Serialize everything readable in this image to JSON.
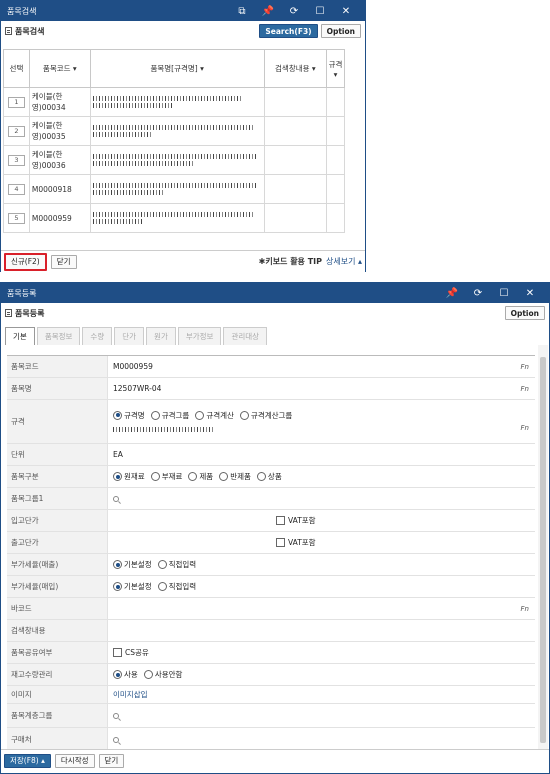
{
  "search_window": {
    "title": "품목검색",
    "header_title": "품목검색",
    "search_button": "Search(F3)",
    "option_button": "Option",
    "columns": [
      "선택",
      "품목코드 ▾",
      "품목명[규격명] ▾",
      "검색창내용 ▾",
      "규격 ▾"
    ],
    "rows": [
      {
        "num": "1",
        "code": "케이블(한영)00034"
      },
      {
        "num": "2",
        "code": "케이블(한영)00035"
      },
      {
        "num": "3",
        "code": "케이블(한영)00036"
      },
      {
        "num": "4",
        "code": "M0000918"
      },
      {
        "num": "5",
        "code": "M0000959"
      }
    ],
    "new_button": "신규(F2)",
    "close_button": "닫기",
    "tip_text": "✱키보드 활용 TIP",
    "detail_link": "상세보기 ▴"
  },
  "register_window": {
    "title": "품목등록",
    "header_title": "품목등록",
    "option_button": "Option",
    "tabs": [
      "기본",
      "품목정보",
      "수량",
      "단가",
      "원가",
      "부가정보",
      "관리대상"
    ],
    "fields": {
      "item_code": {
        "label": "품목코드",
        "value": "M0000959"
      },
      "item_name": {
        "label": "품목명",
        "value": "12507WR-04"
      },
      "spec": {
        "label": "규격",
        "options": [
          "규격명",
          "규격그룹",
          "규격계산",
          "규격계산그룹"
        ]
      },
      "unit": {
        "label": "단위",
        "value": "EA"
      },
      "item_type": {
        "label": "품목구분",
        "options": [
          "원재료",
          "부재료",
          "제품",
          "반제품",
          "상품"
        ]
      },
      "item_group1": {
        "label": "품목그룹1"
      },
      "purchase_price": {
        "label": "입고단가",
        "vat": "VAT포함"
      },
      "sale_price": {
        "label": "출고단가",
        "vat": "VAT포함"
      },
      "vat_sale": {
        "label": "부가세율(매출)",
        "options": [
          "기본설정",
          "직접입력"
        ]
      },
      "vat_purchase": {
        "label": "부가세율(매입)",
        "options": [
          "기본설정",
          "직접입력"
        ]
      },
      "barcode": {
        "label": "바코드"
      },
      "search_content": {
        "label": "검색창내용"
      },
      "share": {
        "label": "품목공유여부",
        "checkbox": "CS공유"
      },
      "stock_manage": {
        "label": "재고수량관리",
        "options": [
          "사용",
          "사용안함"
        ]
      },
      "image": {
        "label": "이미지",
        "link": "이미지삽입"
      },
      "hierarchy": {
        "label": "품목계층그룹"
      },
      "vendor": {
        "label": "구매처"
      }
    },
    "fn": "Fn",
    "save_button": "저장(F8) ▴",
    "rewrite_button": "다시작성",
    "close_button": "닫기"
  }
}
